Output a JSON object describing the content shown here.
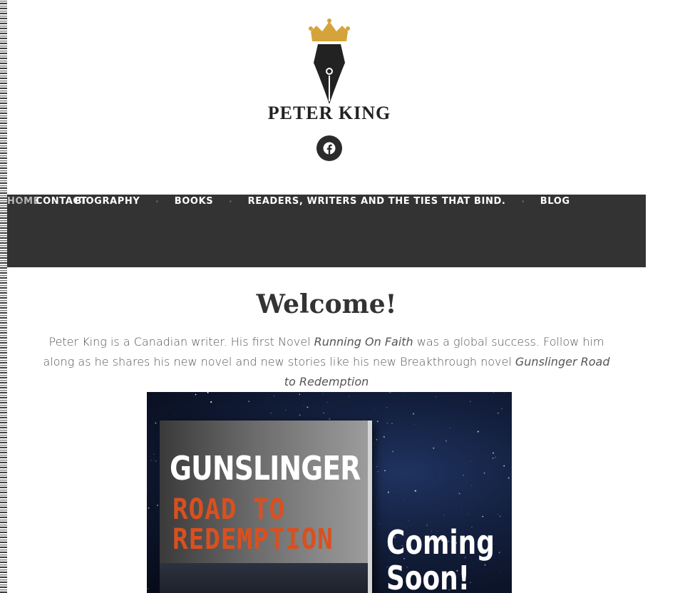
{
  "brand": {
    "name": "PETER KING",
    "social": "facebook"
  },
  "nav": {
    "items": [
      {
        "label": "HOME",
        "active": true
      },
      {
        "label": "BIOGRAPHY"
      },
      {
        "label": "BOOKS"
      },
      {
        "label": "READERS, WRITERS AND THE TIES THAT BIND."
      },
      {
        "label": "BLOG"
      },
      {
        "label": "CONTACT"
      }
    ]
  },
  "main": {
    "title": "Welcome!",
    "intro_1": "Peter King is a Canadian writer.  His first Novel ",
    "intro_book1": "Running On Faith",
    "intro_2": " was a global success.  Follow him along as he shares his new novel and new stories like his new Breakthrough novel ",
    "intro_book2": "Gunslinger Road to Redemption"
  },
  "cover": {
    "title": "GUNSLINGER",
    "subtitle_1": "ROAD TO",
    "subtitle_2": "REDEMPTION",
    "coming_1": "Coming",
    "coming_2": "Soon!"
  },
  "colors": {
    "nav_bg": "#333333",
    "crown": "#d4a43a",
    "subtitle": "#d9501f"
  }
}
